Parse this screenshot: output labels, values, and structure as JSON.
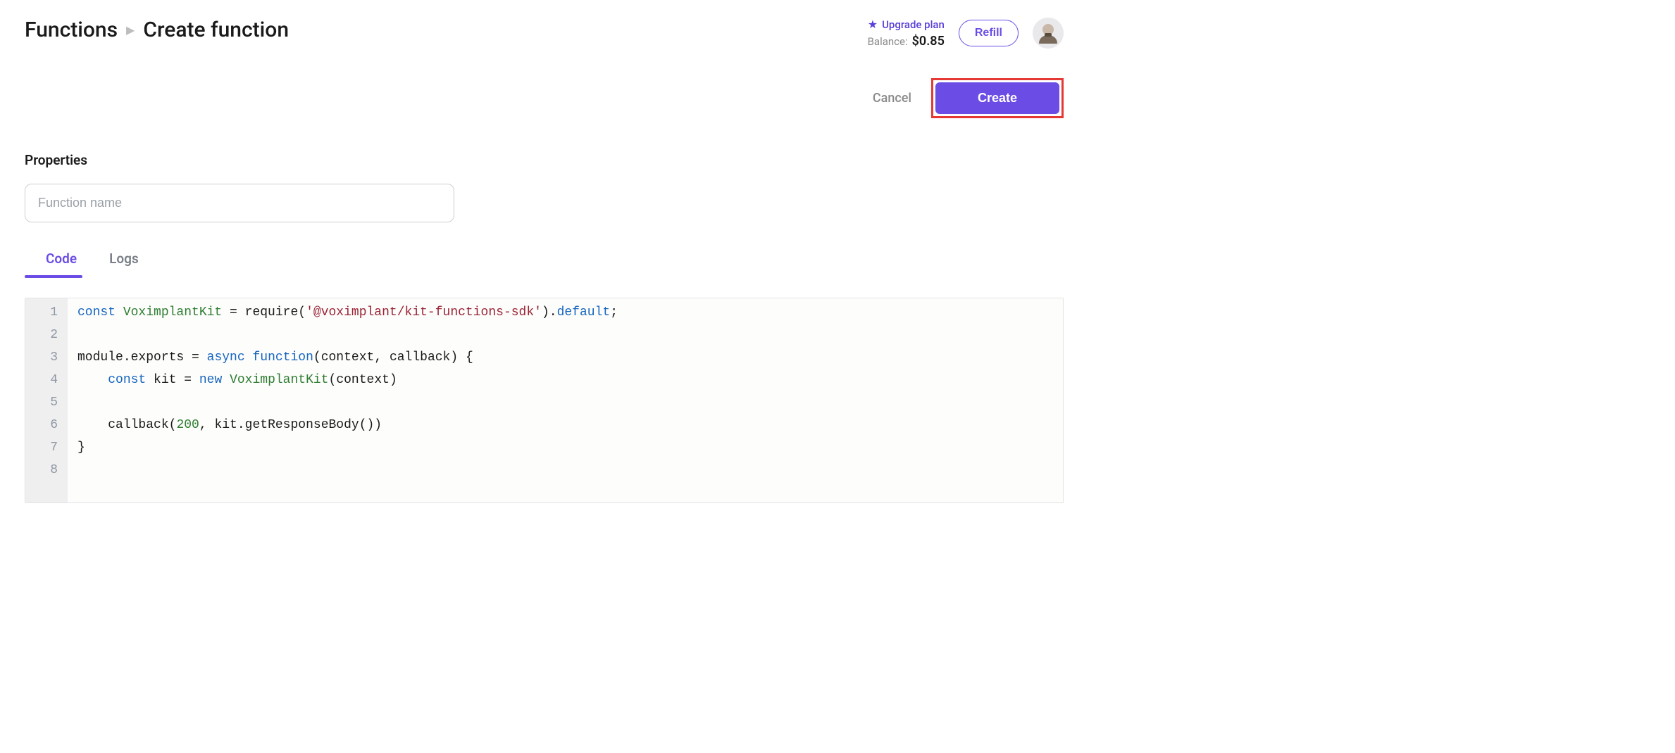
{
  "breadcrumb": {
    "root": "Functions",
    "current": "Create function"
  },
  "header": {
    "upgrade_label": "Upgrade plan",
    "balance_label": "Balance:",
    "balance_amount": "$0.85",
    "refill_label": "Refill"
  },
  "actions": {
    "cancel": "Cancel",
    "create": "Create"
  },
  "properties": {
    "title": "Properties",
    "name_placeholder": "Function name"
  },
  "tabs": {
    "code": "Code",
    "logs": "Logs",
    "active": "code"
  },
  "editor": {
    "line_numbers": [
      "1",
      "2",
      "3",
      "4",
      "5",
      "6",
      "7",
      "8"
    ],
    "lines": [
      [
        {
          "t": "const ",
          "c": "kw"
        },
        {
          "t": "VoximplantKit",
          "c": "type"
        },
        {
          "t": " = ",
          "c": "punct"
        },
        {
          "t": "require",
          "c": "plain"
        },
        {
          "t": "(",
          "c": "punct"
        },
        {
          "t": "'@voximplant/kit-functions-sdk'",
          "c": "str"
        },
        {
          "t": ").",
          "c": "punct"
        },
        {
          "t": "default",
          "c": "kw"
        },
        {
          "t": ";",
          "c": "punct"
        }
      ],
      [],
      [
        {
          "t": "module",
          "c": "plain"
        },
        {
          "t": ".",
          "c": "punct"
        },
        {
          "t": "exports",
          "c": "plain"
        },
        {
          "t": " = ",
          "c": "punct"
        },
        {
          "t": "async ",
          "c": "kw"
        },
        {
          "t": "function",
          "c": "kw"
        },
        {
          "t": "(",
          "c": "punct"
        },
        {
          "t": "context",
          "c": "plain"
        },
        {
          "t": ", ",
          "c": "punct"
        },
        {
          "t": "callback",
          "c": "plain"
        },
        {
          "t": ") {",
          "c": "punct"
        }
      ],
      [
        {
          "t": "    ",
          "c": "plain"
        },
        {
          "t": "const ",
          "c": "kw"
        },
        {
          "t": "kit",
          "c": "plain"
        },
        {
          "t": " = ",
          "c": "punct"
        },
        {
          "t": "new ",
          "c": "kw"
        },
        {
          "t": "VoximplantKit",
          "c": "type"
        },
        {
          "t": "(",
          "c": "punct"
        },
        {
          "t": "context",
          "c": "plain"
        },
        {
          "t": ")",
          "c": "punct"
        }
      ],
      [],
      [
        {
          "t": "    callback",
          "c": "plain"
        },
        {
          "t": "(",
          "c": "punct"
        },
        {
          "t": "200",
          "c": "num"
        },
        {
          "t": ", ",
          "c": "punct"
        },
        {
          "t": "kit",
          "c": "plain"
        },
        {
          "t": ".",
          "c": "punct"
        },
        {
          "t": "getResponseBody",
          "c": "plain"
        },
        {
          "t": "())",
          "c": "punct"
        }
      ],
      [
        {
          "t": "}",
          "c": "punct"
        }
      ],
      []
    ]
  }
}
